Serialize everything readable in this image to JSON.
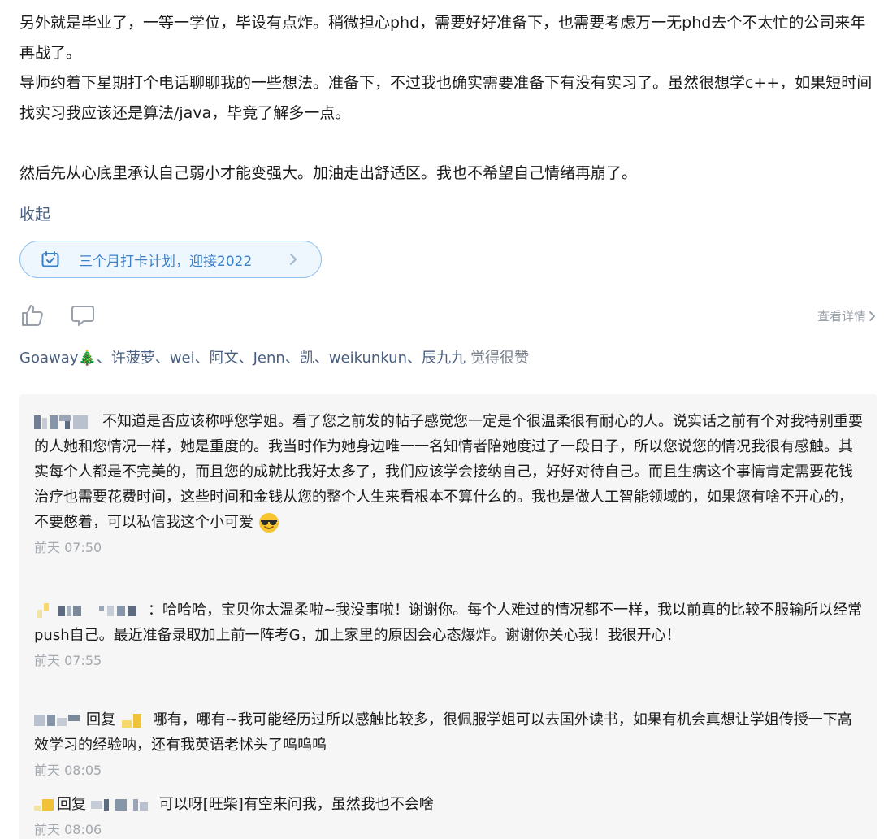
{
  "post": {
    "paragraph1": "另外就是毕业了，一等一学位，毕设有点炸。稍微担心phd，需要好好准备下，也需要考虑万一无phd去个不太忙的公司来年再战了。",
    "paragraph2": "导师约着下星期打个电话聊聊我的一些想法。准备下，不过我也确实需要准备下有没有实习了。虽然很想学c++，如果短时间找实习我应该还是算法/java，毕竟了解多一点。",
    "paragraph3": "然后先从心底里承认自己弱小才能变强大。加油走出舒适区。我也不希望自己情绪再崩了。",
    "collapse_label": "收起"
  },
  "topic": {
    "label": "三个月打卡计划，迎接2022",
    "icon": "calendar-check-icon"
  },
  "actions": {
    "like_icon": "thumbs-up-icon",
    "comment_icon": "comment-bubble-icon",
    "detail_label": "查看详情"
  },
  "likers": {
    "names": [
      "Goaway🎄",
      "许菠萝",
      "wei",
      "阿文",
      "Jenn",
      "凯",
      "weikunkun",
      "辰九九"
    ],
    "separator": "、",
    "suffix": "觉得很赞"
  },
  "comments": [
    {
      "text": "不知道是否应该称呼您学姐。看了您之前发的帖子感觉您一定是个很温柔很有耐心的人。说实话之前有个对我特别重要的人她和您情况一样，她是重度的。我当时作为她身边唯一一名知情者陪她度过了一段日子，所以您说您的情况我很有感触。其实每个人都是不完美的，而且您的成就比我好太多了，我们应该学会接纳自己，好好对待自己。而且生病这个事情肯定需要花钱治疗也需要花费时间，这些时间和金钱从您的整个人生来看根本不算什么的。我也是做人工智能领域的，如果您有啥不开心的，不要憋着，可以私信我这个小可爱",
      "emoji": "😎",
      "time": "前天 07:50"
    },
    {
      "text": "：哈哈哈，宝贝你太温柔啦~我没事啦！谢谢你。每个人难过的情况都不一样，我以前真的比较不服输所以经常push自己。最近准备录取加上前一阵考G，加上家里的原因会心态爆炸。谢谢你关心我！我很开心！",
      "time": "前天 07:55"
    },
    {
      "reply_label": "回复",
      "text": "哪有，哪有~我可能经历过所以感触比较多，很佩服学姐可以去国外读书，如果有机会真想让学姐传授一下高效学习的经验呐，还有我英语老怵头了呜呜呜",
      "time": "前天 08:05"
    },
    {
      "reply_label": "回复",
      "text": "可以呀[旺柴]有空来问我，虽然我也不会啥",
      "time": "前天 08:06"
    }
  ],
  "colors": {
    "link": "#4a5f7f",
    "topic_text": "#3d7fc4",
    "topic_border": "#8fc1ee",
    "topic_bg": "#eef6fe",
    "comment_bg": "#f6f6f6",
    "muted": "#a3a8ae"
  }
}
